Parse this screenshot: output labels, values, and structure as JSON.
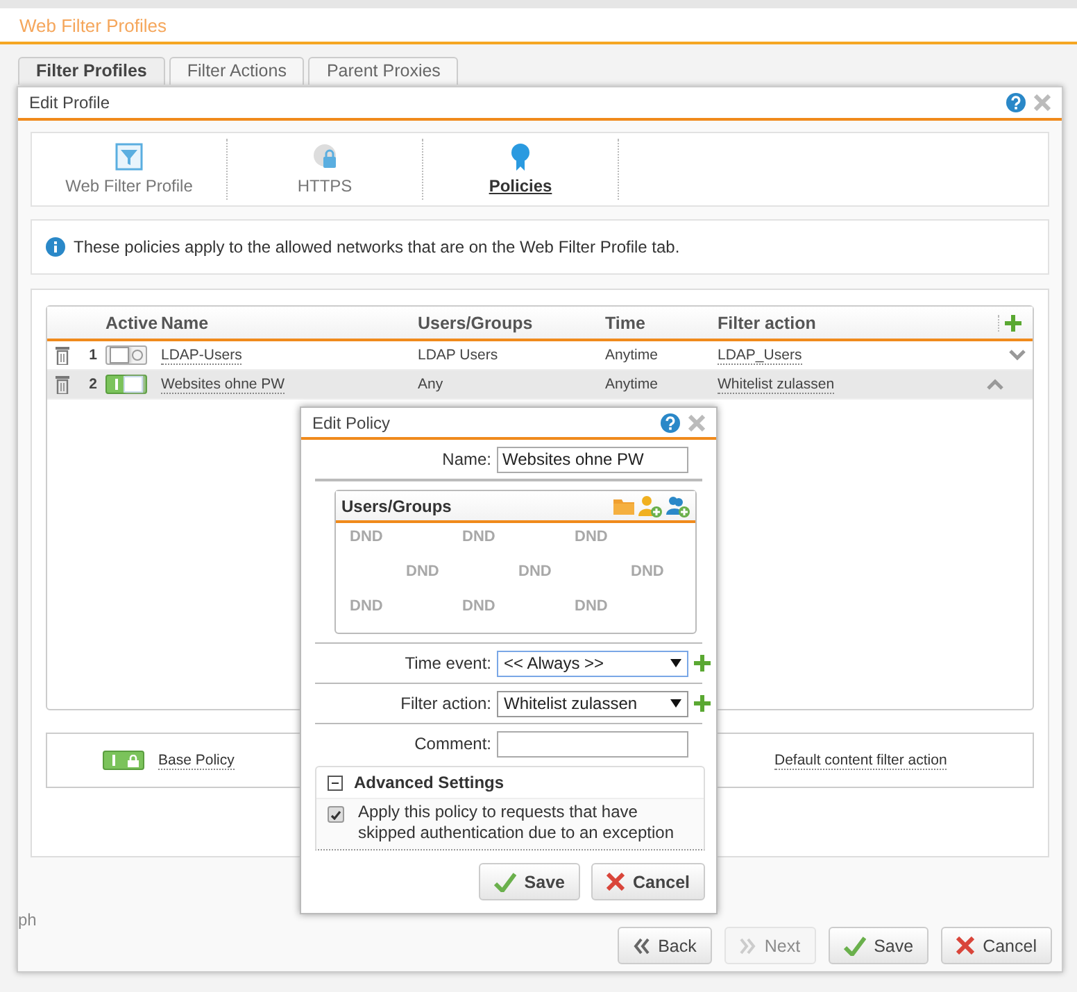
{
  "page": {
    "title": "Web Filter Profiles"
  },
  "tabs": [
    {
      "label": "Filter Profiles",
      "selected": true
    },
    {
      "label": "Filter Actions",
      "selected": false
    },
    {
      "label": "Parent Proxies",
      "selected": false
    }
  ],
  "edit_profile": {
    "title": "Edit Profile",
    "sections": [
      {
        "label": "Web Filter Profile",
        "kind": "funnel",
        "selected": false
      },
      {
        "label": "HTTPS",
        "kind": "globe",
        "selected": false
      },
      {
        "label": "Policies",
        "kind": "ribbon",
        "selected": true
      }
    ],
    "info": "These policies apply to the allowed networks that are on the Web Filter Profile tab.",
    "table": {
      "columns": [
        "Active",
        "Name",
        "Users/Groups",
        "Time",
        "Filter action"
      ],
      "rows": [
        {
          "number": "1",
          "active": false,
          "name": "LDAP-Users",
          "users_groups": "LDAP Users",
          "time": "Anytime",
          "filter_action": "LDAP_Users",
          "selected": false
        },
        {
          "number": "2",
          "active": true,
          "name": "Websites ohne PW",
          "users_groups": "Any",
          "time": "Anytime",
          "filter_action": "Whitelist zulassen",
          "selected": true
        }
      ]
    },
    "base_policy": {
      "active": true,
      "name": "Base Policy",
      "filter_action": "Default content filter action"
    },
    "left_fragment": "ph",
    "buttons": [
      {
        "label": "Back",
        "kind": "back",
        "disabled": false
      },
      {
        "label": "Next",
        "kind": "next",
        "disabled": true
      },
      {
        "label": "Save",
        "kind": "save",
        "disabled": false
      },
      {
        "label": "Cancel",
        "kind": "cancel",
        "disabled": false
      }
    ]
  },
  "edit_policy": {
    "title": "Edit Policy",
    "name_label": "Name:",
    "name_value": "Websites ohne PW",
    "users_groups": {
      "title": "Users/Groups",
      "dnd_marks": [
        "DND",
        "DND",
        "DND",
        "DND",
        "DND",
        "DND",
        "DND",
        "DND",
        "DND"
      ]
    },
    "time_label": "Time event:",
    "time_value": "<< Always >>",
    "filter_label": "Filter action:",
    "filter_value": "Whitelist zulassen",
    "comment_label": "Comment:",
    "advanced": {
      "title": "Advanced Settings",
      "expanded": true,
      "checked": true,
      "text": "Apply this policy to requests that have skipped authentication due to an exception"
    },
    "buttons": [
      {
        "label": "Save",
        "kind": "save"
      },
      {
        "label": "Cancel",
        "kind": "cancel"
      }
    ]
  }
}
